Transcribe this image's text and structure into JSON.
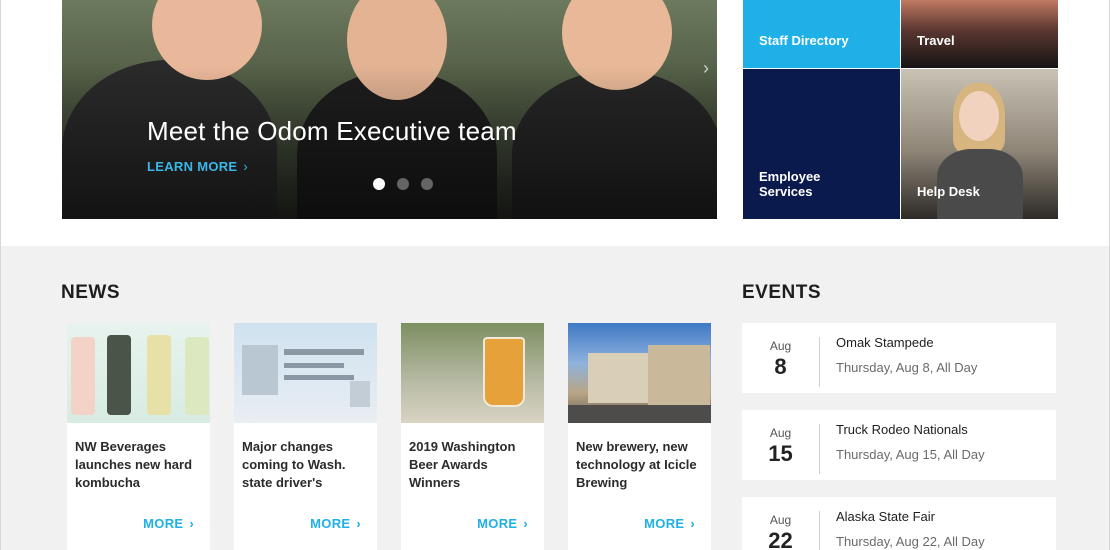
{
  "hero": {
    "title": "Meet the Odom Executive team",
    "link_label": "LEARN MORE",
    "slides_total": 3,
    "active_slide": 1
  },
  "tiles": [
    {
      "label": "Staff Directory",
      "icon": "staff-directory"
    },
    {
      "label": "Travel",
      "icon": "travel"
    },
    {
      "label": "Employee Services",
      "icon": "employee-services"
    },
    {
      "label": "Help Desk",
      "icon": "help-desk"
    }
  ],
  "news": {
    "title": "NEWS",
    "items": [
      {
        "headline": "NW Beverages launches new hard kombucha",
        "more": "MORE"
      },
      {
        "headline": "Major changes coming to Wash. state driver's",
        "more": "MORE"
      },
      {
        "headline": "2019 Washington Beer Awards Winners",
        "more": "MORE"
      },
      {
        "headline": "New brewery, new technology at Icicle Brewing",
        "more": "MORE"
      }
    ]
  },
  "events": {
    "title": "EVENTS",
    "items": [
      {
        "month": "Aug",
        "day": "8",
        "name": "Omak Stampede",
        "when": "Thursday, Aug 8, All Day"
      },
      {
        "month": "Aug",
        "day": "15",
        "name": "Truck Rodeo Nationals",
        "when": "Thursday, Aug 15, All Day"
      },
      {
        "month": "Aug",
        "day": "22",
        "name": "Alaska State Fair",
        "when": "Thursday, Aug 22, All Day"
      }
    ]
  },
  "colors": {
    "accent": "#1fb0e8",
    "navy": "#0b1a4d",
    "section_bg": "#f1f1f1"
  }
}
